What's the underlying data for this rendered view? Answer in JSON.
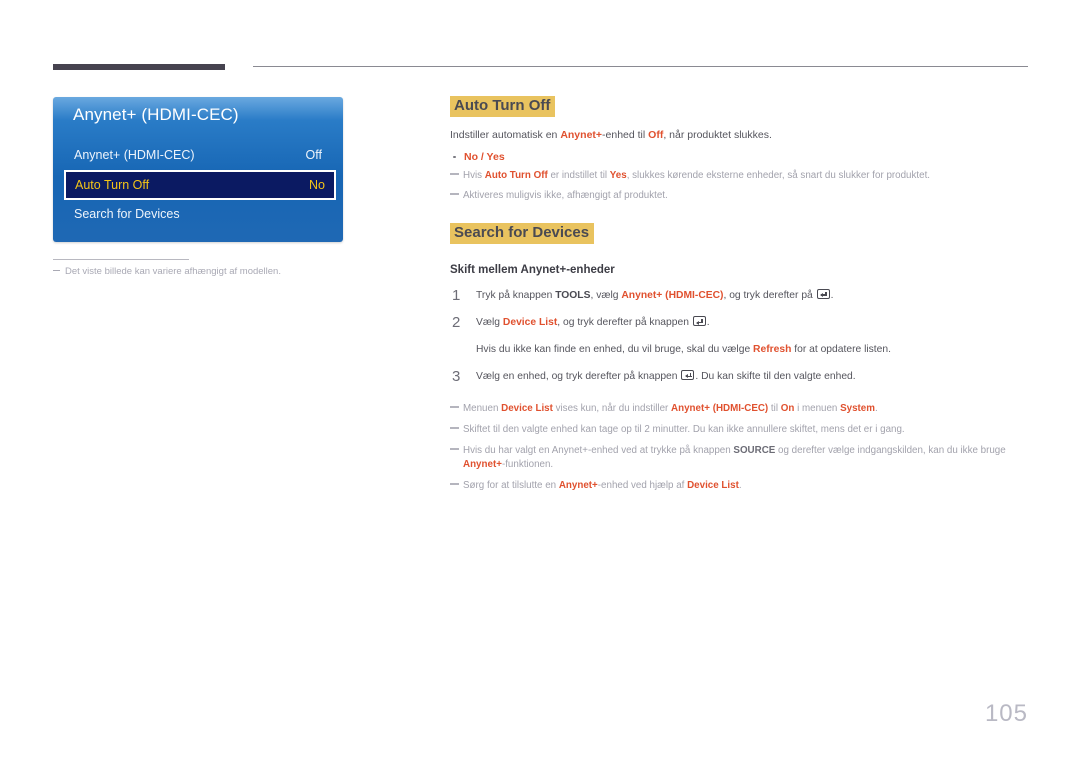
{
  "page": {
    "number": "105",
    "caption": "Det viste billede kan variere afhængigt af modellen.",
    "caption_dash_icon": "dash-icon"
  },
  "osd": {
    "title": "Anynet+ (HDMI-CEC)",
    "rows": [
      {
        "label": "Anynet+ (HDMI-CEC)",
        "value": "Off",
        "selected": false
      },
      {
        "label": "Auto Turn Off",
        "value": "No",
        "selected": true
      },
      {
        "label": "Search for Devices",
        "value": "",
        "selected": false
      }
    ],
    "colors": {
      "background_top": "#6aa9e0",
      "background_bottom": "#1f68b4",
      "selected_background": "#0b1a62",
      "selected_text": "#f5c518",
      "selected_border": "#ffffff"
    }
  },
  "sections": {
    "auto_turn_off": {
      "heading": "Auto Turn Off",
      "heading_highlight": "#e9c35f",
      "intro": {
        "part1": "Indstiller automatisk en ",
        "em1": "Anynet+",
        "part2": "-enhed til ",
        "em2": "Off",
        "part3": ", når produktet slukkes."
      },
      "bullet": "No / Yes",
      "notes": [
        {
          "part1": "Hvis ",
          "em1": "Auto Turn Off",
          "part2": " er indstillet til ",
          "em2": "Yes",
          "part3": ", slukkes kørende eksterne enheder, så snart du slukker for produktet."
        },
        {
          "part1": "Aktiveres muligvis ikke, afhængigt af produktet.",
          "em1": "",
          "part2": "",
          "em2": "",
          "part3": ""
        }
      ]
    },
    "search_for_devices": {
      "heading": "Search for Devices",
      "heading_highlight": "#e9c35f",
      "subheading": "Skift mellem Anynet+-enheder",
      "steps": [
        {
          "num": "1",
          "part1": "Tryk på knappen ",
          "strong": "TOOLS",
          "part2": ", vælg ",
          "em": "Anynet+ (HDMI-CEC)",
          "part3": ", og tryk derefter på ",
          "icon": "enter-key-icon",
          "part4": "."
        },
        {
          "num": "2",
          "part1": "Vælg ",
          "strong": "",
          "part2": "",
          "em": "Device List",
          "part3": ", og tryk derefter på knappen ",
          "icon": "enter-key-icon",
          "part4": "."
        },
        {
          "num": "3",
          "part1": "Vælg en enhed, og tryk derefter på knappen ",
          "strong": "",
          "part2": "",
          "em": "",
          "part3": "",
          "icon": "enter-key-icon",
          "part4": ". Du kan skifte til den valgte enhed."
        }
      ],
      "substep": {
        "part1": "Hvis du ikke kan finde en enhed, du vil bruge, skal du vælge ",
        "em": "Refresh",
        "part2": " for at opdatere listen."
      },
      "notes": [
        {
          "p1": "Menuen ",
          "e1": "Device List",
          "p2": " vises kun, når du indstiller ",
          "e2": "Anynet+ (HDMI-CEC)",
          "p3": " til ",
          "e3": "On",
          "p4": " i menuen ",
          "e4": "System",
          "p5": "."
        },
        {
          "p1": "Skiftet til den valgte enhed kan tage op til 2 minutter. Du kan ikke annullere skiftet, mens det er i gang.",
          "e1": "",
          "p2": "",
          "e2": "",
          "p3": "",
          "e3": "",
          "p4": "",
          "e4": "",
          "p5": ""
        },
        {
          "p1": "Hvis du har valgt en Anynet+-enhed ved at trykke på knappen ",
          "e1": "SOURCE",
          "p2": " og derefter vælge indgangskilden, kan du ikke bruge ",
          "e2": "Anynet+",
          "p3": "-funktionen.",
          "e3": "",
          "p4": "",
          "e4": "",
          "p5": ""
        },
        {
          "p1": "Sørg for at tilslutte en ",
          "e1": "Anynet+",
          "p2": "-enhed ved hjælp af ",
          "e2": "Device List",
          "p3": ".",
          "e3": "",
          "p4": "",
          "e4": "",
          "p5": ""
        }
      ]
    }
  }
}
